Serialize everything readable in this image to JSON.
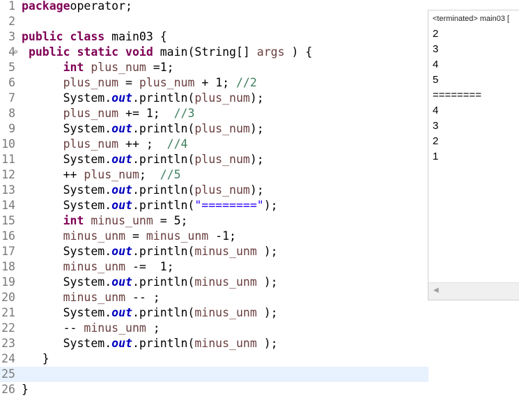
{
  "editor": {
    "lines": [
      {
        "n": "1",
        "fold": "",
        "tokens": [
          [
            "kw",
            "package"
          ],
          [
            "",
            "operator;"
          ]
        ]
      },
      {
        "n": "2",
        "fold": "",
        "tokens": []
      },
      {
        "n": "3",
        "fold": "",
        "tokens": [
          [
            "kw",
            "public"
          ],
          [
            "",
            " "
          ],
          [
            "kw",
            "class"
          ],
          [
            "",
            " main03 {"
          ]
        ]
      },
      {
        "n": "4",
        "fold": "⊖",
        "tokens": [
          [
            "",
            " "
          ],
          [
            "kw",
            "public"
          ],
          [
            "",
            " "
          ],
          [
            "kw",
            "static"
          ],
          [
            "",
            " "
          ],
          [
            "kw",
            "void"
          ],
          [
            "",
            " main(String[] "
          ],
          [
            "var",
            "args"
          ],
          [
            "",
            " ) {"
          ]
        ]
      },
      {
        "n": "5",
        "fold": "",
        "tokens": [
          [
            "",
            "      "
          ],
          [
            "kw",
            "int"
          ],
          [
            "",
            " "
          ],
          [
            "var",
            "plus_num"
          ],
          [
            "",
            " =1;"
          ]
        ]
      },
      {
        "n": "6",
        "fold": "",
        "tokens": [
          [
            "",
            "      "
          ],
          [
            "var",
            "plus_num"
          ],
          [
            "",
            " = "
          ],
          [
            "var",
            "plus_num"
          ],
          [
            "",
            " + 1; "
          ],
          [
            "com",
            "//2"
          ]
        ]
      },
      {
        "n": "7",
        "fold": "",
        "tokens": [
          [
            "",
            "      System."
          ],
          [
            "fld",
            "out"
          ],
          [
            "",
            ".println("
          ],
          [
            "var",
            "plus_num"
          ],
          [
            "",
            ");"
          ]
        ]
      },
      {
        "n": "8",
        "fold": "",
        "tokens": [
          [
            "",
            "      "
          ],
          [
            "var",
            "plus_num"
          ],
          [
            "",
            " += 1;  "
          ],
          [
            "com",
            "//3"
          ]
        ]
      },
      {
        "n": "9",
        "fold": "",
        "tokens": [
          [
            "",
            "      System."
          ],
          [
            "fld",
            "out"
          ],
          [
            "",
            ".println("
          ],
          [
            "var",
            "plus_num"
          ],
          [
            "",
            ");"
          ]
        ]
      },
      {
        "n": "10",
        "fold": "",
        "tokens": [
          [
            "",
            "      "
          ],
          [
            "var",
            "plus_num"
          ],
          [
            "",
            " ++ ;  "
          ],
          [
            "com",
            "//4"
          ]
        ]
      },
      {
        "n": "11",
        "fold": "",
        "tokens": [
          [
            "",
            "      System."
          ],
          [
            "fld",
            "out"
          ],
          [
            "",
            ".println("
          ],
          [
            "var",
            "plus_num"
          ],
          [
            "",
            ");"
          ]
        ]
      },
      {
        "n": "12",
        "fold": "",
        "tokens": [
          [
            "",
            "      ++ "
          ],
          [
            "var",
            "plus_num"
          ],
          [
            "",
            ";  "
          ],
          [
            "com",
            "//5"
          ]
        ]
      },
      {
        "n": "13",
        "fold": "",
        "tokens": [
          [
            "",
            "      System."
          ],
          [
            "fld",
            "out"
          ],
          [
            "",
            ".println("
          ],
          [
            "var",
            "plus_num"
          ],
          [
            "",
            ");"
          ]
        ]
      },
      {
        "n": "14",
        "fold": "",
        "tokens": [
          [
            "",
            "      System."
          ],
          [
            "fld",
            "out"
          ],
          [
            "",
            ".println("
          ],
          [
            "str",
            "\"========\""
          ],
          [
            "",
            ");"
          ]
        ]
      },
      {
        "n": "15",
        "fold": "",
        "tokens": [
          [
            "",
            "      "
          ],
          [
            "kw",
            "int"
          ],
          [
            "",
            " "
          ],
          [
            "var",
            "minus_unm"
          ],
          [
            "",
            " = 5;"
          ]
        ]
      },
      {
        "n": "16",
        "fold": "",
        "tokens": [
          [
            "",
            "      "
          ],
          [
            "var",
            "minus_unm"
          ],
          [
            "",
            " = "
          ],
          [
            "var",
            "minus_unm"
          ],
          [
            "",
            " -1;"
          ]
        ]
      },
      {
        "n": "17",
        "fold": "",
        "tokens": [
          [
            "",
            "      System."
          ],
          [
            "fld",
            "out"
          ],
          [
            "",
            ".println("
          ],
          [
            "var",
            "minus_unm"
          ],
          [
            "",
            " );"
          ]
        ]
      },
      {
        "n": "18",
        "fold": "",
        "tokens": [
          [
            "",
            "      "
          ],
          [
            "var",
            "minus_unm"
          ],
          [
            "",
            " -=  1;"
          ]
        ]
      },
      {
        "n": "19",
        "fold": "",
        "tokens": [
          [
            "",
            "      System."
          ],
          [
            "fld",
            "out"
          ],
          [
            "",
            ".println("
          ],
          [
            "var",
            "minus_unm"
          ],
          [
            "",
            " );"
          ]
        ]
      },
      {
        "n": "20",
        "fold": "",
        "tokens": [
          [
            "",
            "      "
          ],
          [
            "var",
            "minus_unm"
          ],
          [
            "",
            " -- ;"
          ]
        ]
      },
      {
        "n": "21",
        "fold": "",
        "tokens": [
          [
            "",
            "      System."
          ],
          [
            "fld",
            "out"
          ],
          [
            "",
            ".println("
          ],
          [
            "var",
            "minus_unm"
          ],
          [
            "",
            " );"
          ]
        ]
      },
      {
        "n": "22",
        "fold": "",
        "tokens": [
          [
            "",
            "      -- "
          ],
          [
            "var",
            "minus_unm"
          ],
          [
            "",
            " ;"
          ]
        ]
      },
      {
        "n": "23",
        "fold": "",
        "tokens": [
          [
            "",
            "      System."
          ],
          [
            "fld",
            "out"
          ],
          [
            "",
            ".println("
          ],
          [
            "var",
            "minus_unm"
          ],
          [
            "",
            " );"
          ]
        ]
      },
      {
        "n": "24",
        "fold": "",
        "tokens": [
          [
            "",
            "   }"
          ]
        ]
      },
      {
        "n": "25",
        "fold": "",
        "tokens": [],
        "current": true
      },
      {
        "n": "26",
        "fold": "",
        "tokens": [
          [
            "",
            "}"
          ]
        ]
      }
    ]
  },
  "console": {
    "header": "<terminated> main03 [",
    "output": [
      "2",
      "3",
      "4",
      "5",
      "========",
      "4",
      "3",
      "2",
      "1"
    ],
    "scroll_left_icon": "◀"
  }
}
